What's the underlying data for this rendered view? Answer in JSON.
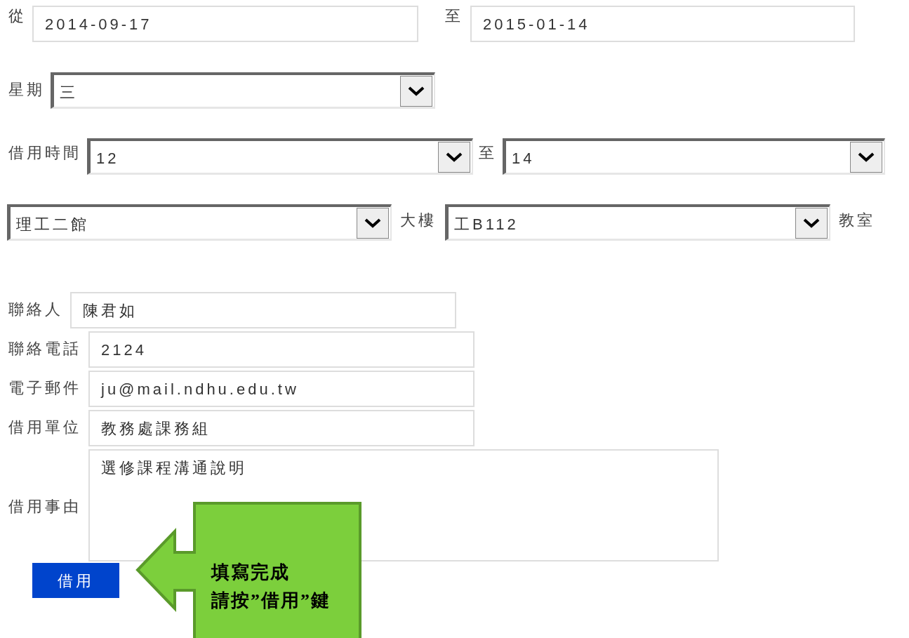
{
  "date_range": {
    "from_label": "從",
    "from": "2014-09-17",
    "to_label": "至",
    "to": "2015-01-14"
  },
  "weekday": {
    "label": "星期",
    "value": "三"
  },
  "time": {
    "label": "借用時間",
    "from": "12",
    "to_label": "至",
    "to": "14"
  },
  "location": {
    "building": "理工二館",
    "building_label": "大樓",
    "room": "工B112",
    "room_label": "教室"
  },
  "contact_fields": [
    {
      "label": "聯絡人",
      "value": "陳君如"
    },
    {
      "label": "聯絡電話",
      "value": "2124"
    },
    {
      "label": "電子郵件",
      "value": "ju@mail.ndhu.edu.tw"
    },
    {
      "label": "借用單位",
      "value": "教務處課務組"
    }
  ],
  "reason": {
    "label": "借用事由",
    "value": "選修課程溝通說明"
  },
  "submit_button": "借用",
  "callout": {
    "lines": [
      "填寫完成",
      "請按”借用”鍵"
    ]
  }
}
